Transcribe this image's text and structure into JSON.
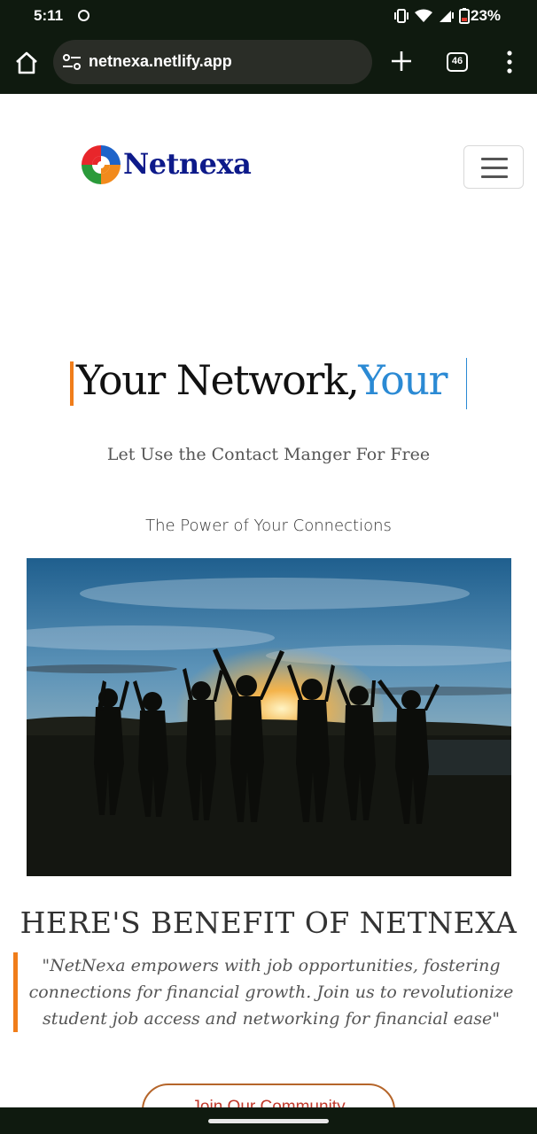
{
  "status_bar": {
    "time": "5:11",
    "battery_percent": "23%",
    "icons": [
      "whatsapp-icon",
      "vibrate-icon",
      "wifi-icon",
      "signal-icon",
      "battery-icon"
    ]
  },
  "browser": {
    "url": "netnexa.netlify.app",
    "tab_count": "46"
  },
  "site": {
    "brand": "Netnexa",
    "hero": {
      "title_part1": "Your Network,",
      "title_part2": "Your ",
      "subtitle": "Let Use the Contact Manger For Free",
      "tagline": "The Power of Your Connections"
    },
    "benefit": {
      "title": "HERE'S BENEFIT OF NETNEXA",
      "quote": "\"NetNexa empowers with job opportunities, fostering connections for financial growth. Join us to revolutionize student job access and networking for financial ease\""
    },
    "cta_label": "Join Our Community"
  },
  "colors": {
    "accent_orange": "#f07d1a",
    "accent_blue": "#2b8ad4",
    "brand_navy": "#0d1a8a",
    "browser_chrome": "#0f1a0f"
  }
}
